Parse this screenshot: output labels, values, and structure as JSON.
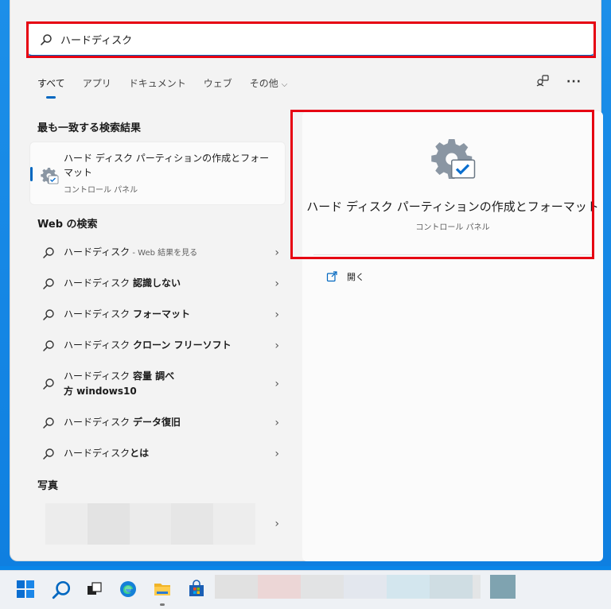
{
  "search": {
    "value": "ハードディスク",
    "placeholder": ""
  },
  "tabs": [
    {
      "label": "すべて",
      "active": true
    },
    {
      "label": "アプリ"
    },
    {
      "label": "ドキュメント"
    },
    {
      "label": "ウェブ"
    },
    {
      "label": "その他",
      "has_chevron": true
    }
  ],
  "toolbar_icons": [
    "account-switch-icon",
    "more-options-icon"
  ],
  "best_match": {
    "section_title": "最も一致する検索結果",
    "title": "ハード ディスク パーティションの作成とフォーマット",
    "subtitle": "コントロール パネル",
    "icon": "settings-gear-check-icon"
  },
  "web_search": {
    "section_title": "Web の検索",
    "items": [
      {
        "prefix": "ハードディスク",
        "bold": "",
        "suffix": " - Web 結果を見る"
      },
      {
        "prefix": "ハードディスク ",
        "bold": "認識しない",
        "suffix": ""
      },
      {
        "prefix": "ハードディスク ",
        "bold": "フォーマット",
        "suffix": ""
      },
      {
        "prefix": "ハードディスク ",
        "bold": "クローン フリーソフト",
        "suffix": ""
      },
      {
        "prefix": "ハードディスク ",
        "bold": "容量 調べ方 windows10",
        "suffix": ""
      },
      {
        "prefix": "ハードディスク ",
        "bold": "データ復旧",
        "suffix": ""
      },
      {
        "prefix": "ハードディスク",
        "bold": "とは",
        "suffix": ""
      }
    ]
  },
  "photos": {
    "section_title": "写真"
  },
  "detail": {
    "title": "ハード ディスク パーティションの作成とフォーマット",
    "subtitle": "コントロール パネル",
    "open_label": "開く"
  },
  "taskbar": {
    "items": [
      "start-icon",
      "search-icon",
      "task-view-icon",
      "edge-icon",
      "file-explorer-icon",
      "store-icon"
    ]
  },
  "highlight_color": "#e60012",
  "accent_color": "#0067c0"
}
